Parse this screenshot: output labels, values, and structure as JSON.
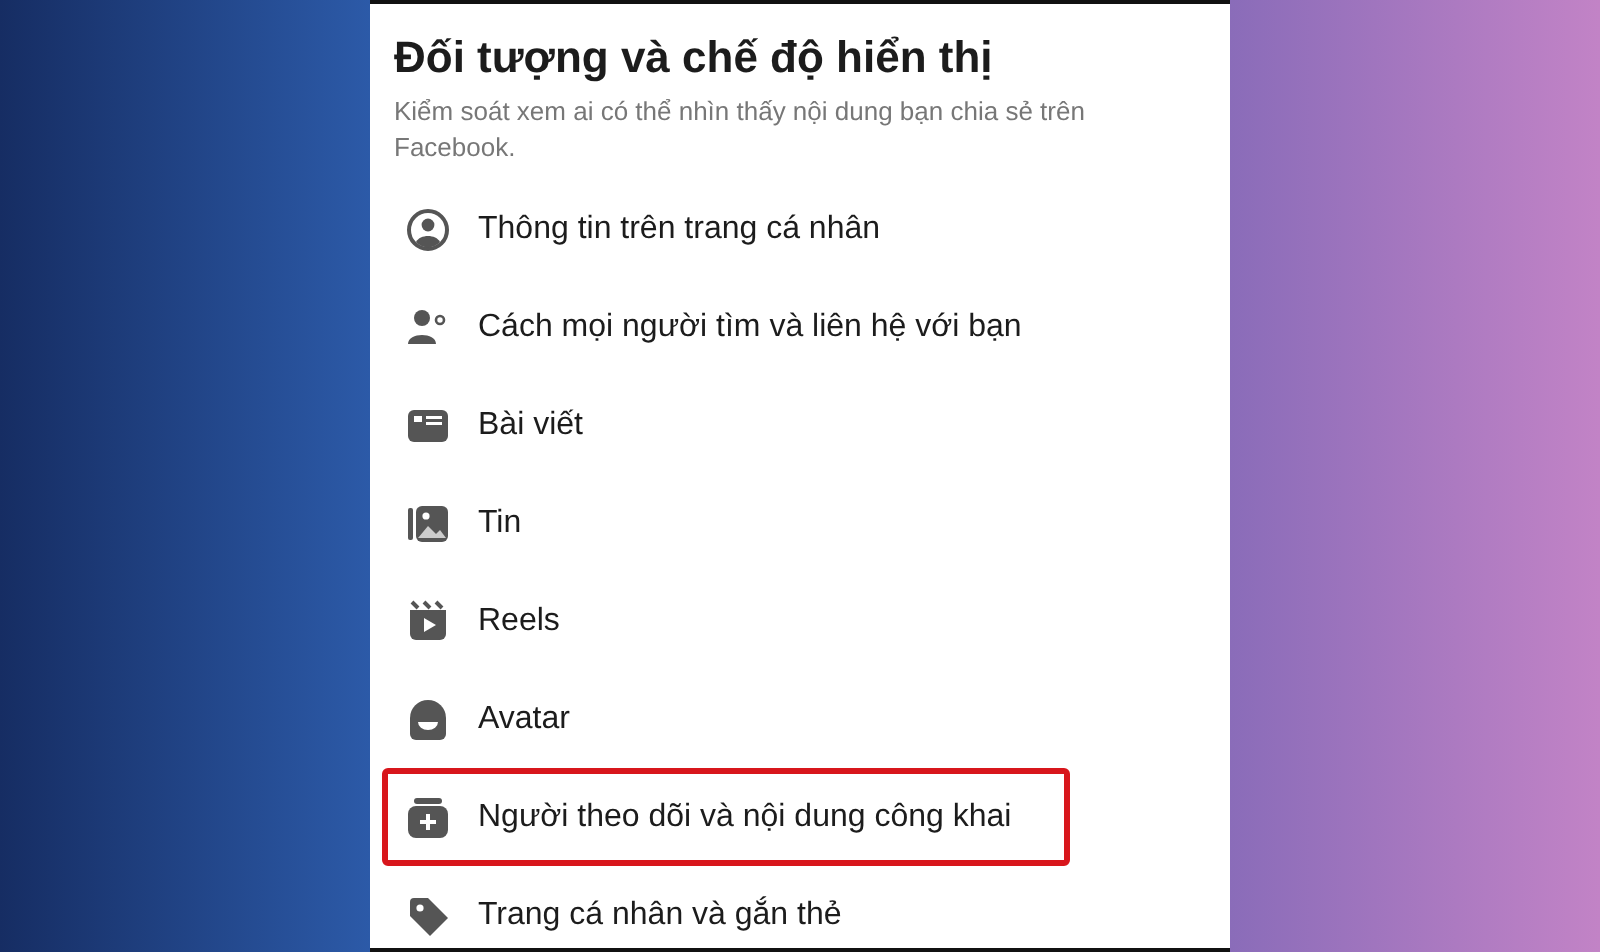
{
  "title": "Đối tượng và chế độ hiển thị",
  "subtitle": "Kiểm soát xem ai có thể nhìn thấy nội dung bạn chia sẻ trên Facebook.",
  "items": [
    {
      "kind": "profile",
      "label": "Thông tin trên trang cá nhân",
      "highlighted": false
    },
    {
      "kind": "find",
      "label": "Cách mọi người tìm và liên hệ với bạn",
      "highlighted": false
    },
    {
      "kind": "post",
      "label": "Bài viết",
      "highlighted": false
    },
    {
      "kind": "story",
      "label": "Tin",
      "highlighted": false
    },
    {
      "kind": "reels",
      "label": "Reels",
      "highlighted": false
    },
    {
      "kind": "avatar",
      "label": "Avatar",
      "highlighted": false
    },
    {
      "kind": "followers",
      "label": "Người theo dõi và nội dung công khai",
      "highlighted": true
    },
    {
      "kind": "tag",
      "label": "Trang cá nhân và gắn thẻ",
      "highlighted": false
    }
  ]
}
